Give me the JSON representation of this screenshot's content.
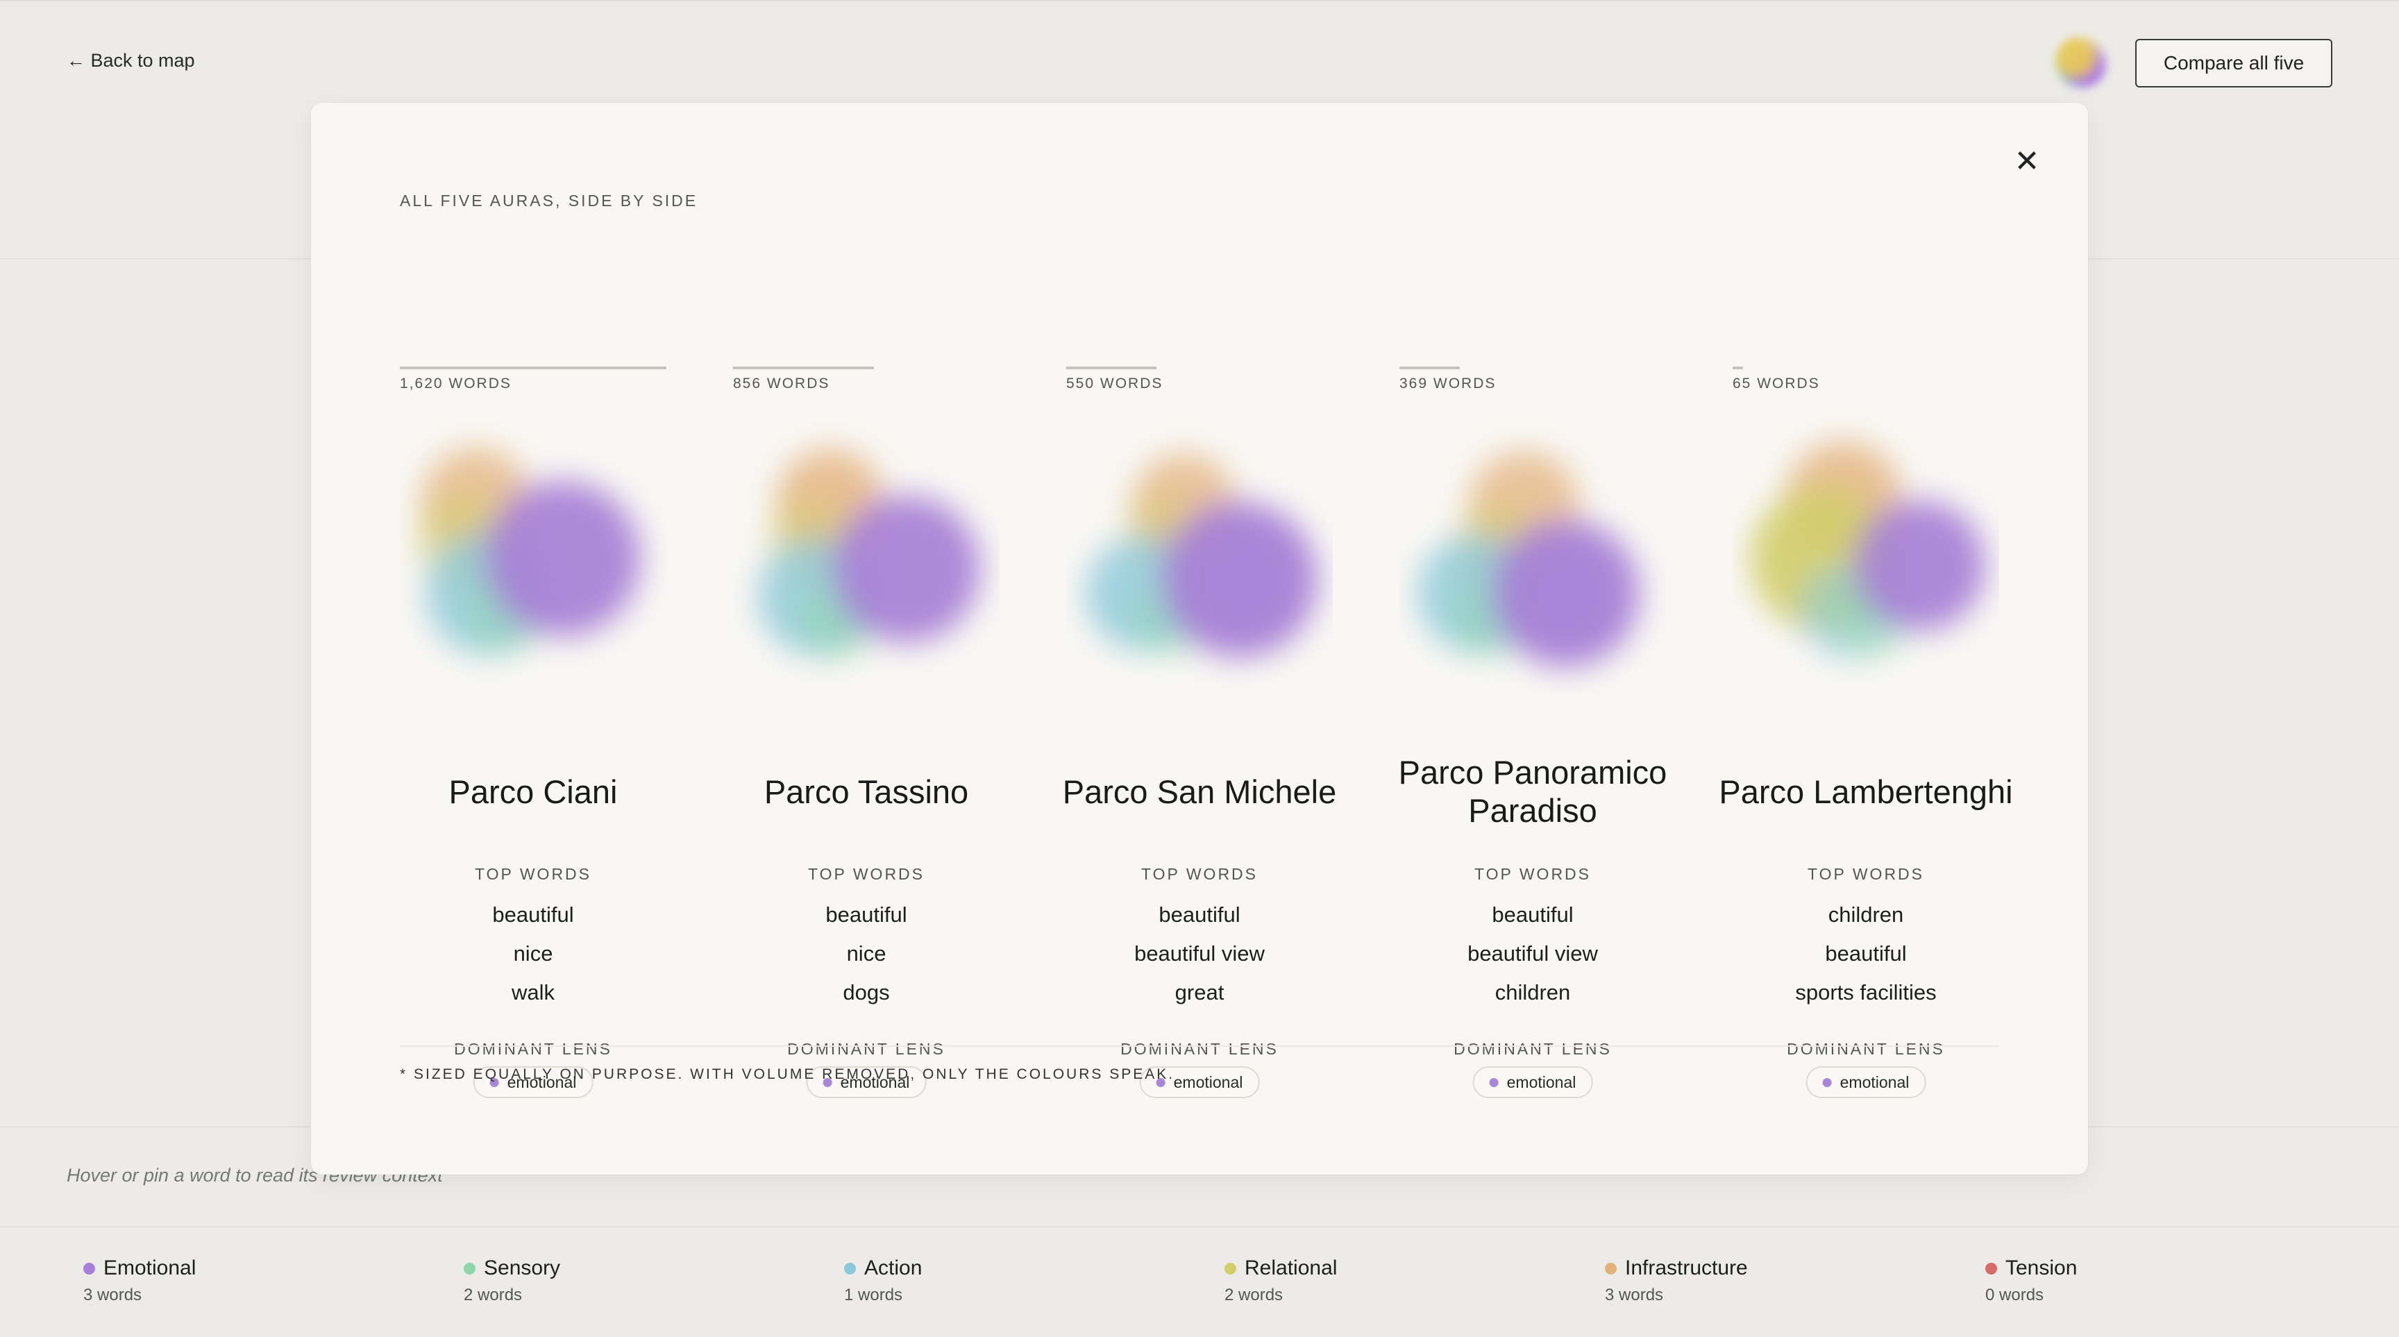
{
  "header": {
    "back_label": "← Back to map",
    "compare_label": "Compare all five"
  },
  "hint": "Hover or pin a word to read its review context",
  "modal": {
    "eyebrow": "ALL FIVE AURAS, SIDE BY SIDE",
    "close_glyph": "✕",
    "top_words_label": "TOP WORDS",
    "dominant_lens_label": "DOMINANT LENS",
    "footnote": "* SIZED EQUALLY ON PURPOSE. WITH VOLUME REMOVED, ONLY THE COLOURS SPEAK.",
    "parks": [
      {
        "name": "Parco Ciani",
        "words_label": "1,620 WORDS",
        "word_count": 1620,
        "top_words": [
          "beautiful",
          "nice",
          "walk"
        ],
        "dominant_lens": "emotional"
      },
      {
        "name": "Parco Tassino",
        "words_label": "856 WORDS",
        "word_count": 856,
        "top_words": [
          "beautiful",
          "nice",
          "dogs"
        ],
        "dominant_lens": "emotional"
      },
      {
        "name": "Parco San Michele",
        "words_label": "550 WORDS",
        "word_count": 550,
        "top_words": [
          "beautiful",
          "beautiful view",
          "great"
        ],
        "dominant_lens": "emotional"
      },
      {
        "name": "Parco Panoramico Paradiso",
        "words_label": "369 WORDS",
        "word_count": 369,
        "top_words": [
          "beautiful",
          "beautiful view",
          "children"
        ],
        "dominant_lens": "emotional"
      },
      {
        "name": "Parco Lambertenghi",
        "words_label": "65 WORDS",
        "word_count": 65,
        "top_words": [
          "children",
          "beautiful",
          "sports facilities"
        ],
        "dominant_lens": "emotional"
      }
    ]
  },
  "legend": [
    {
      "name": "Emotional",
      "count": "3 words",
      "color": "#a77fd6"
    },
    {
      "name": "Sensory",
      "count": "2 words",
      "color": "#8fd6ab"
    },
    {
      "name": "Action",
      "count": "1 words",
      "color": "#8cc8da"
    },
    {
      "name": "Relational",
      "count": "2 words",
      "color": "#d2cd6a"
    },
    {
      "name": "Infrastructure",
      "count": "3 words",
      "color": "#e3b17c"
    },
    {
      "name": "Tension",
      "count": "0 words",
      "color": "#d96a6a"
    }
  ],
  "colors": {
    "emotional": "#a77fd6",
    "sensory": "#8fd6ab",
    "action": "#8cc8da",
    "relational": "#d2cd6a",
    "infrastructure": "#e3b17c"
  }
}
